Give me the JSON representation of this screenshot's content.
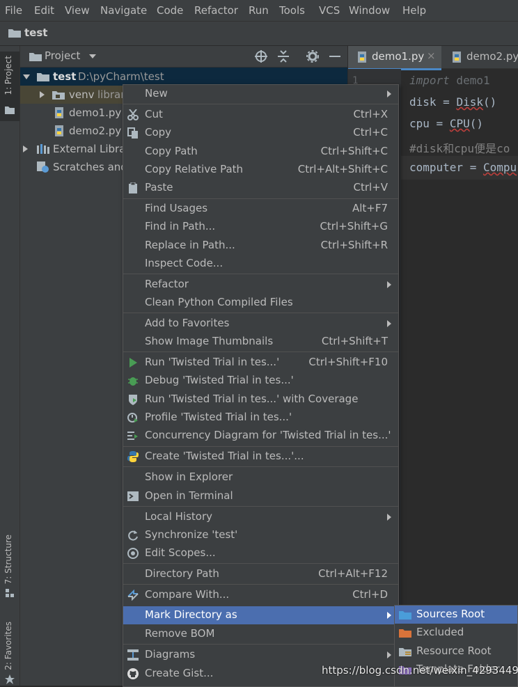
{
  "menu_bar": [
    "File",
    "Edit",
    "View",
    "Navigate",
    "Code",
    "Refactor",
    "Run",
    "Tools",
    "VCS",
    "Window",
    "Help"
  ],
  "navbar": {
    "folder": "test"
  },
  "tool_windows": {
    "project": "1: Project",
    "structure": "7: Structure",
    "favorites": "2: Favorites"
  },
  "project_panel": {
    "title": "Project",
    "tree": [
      {
        "name": "test",
        "path": "D:\\pyCharm\\test"
      },
      {
        "name": "venv",
        "suffix": "librar"
      },
      {
        "name": "demo1.py"
      },
      {
        "name": "demo2.py"
      },
      {
        "name": "External Librar"
      },
      {
        "name": "Scratches and"
      }
    ]
  },
  "editor": {
    "tabs": [
      "demo1.py",
      "demo2.py"
    ],
    "line_number": "1",
    "lines": {
      "l1_kw": "import",
      "l1_rest": " demo1",
      "l2_a": "disk",
      "l2_b": " = ",
      "l2_c": "Disk",
      "l2_d": "()",
      "l3_a": "cpu",
      "l3_b": " = ",
      "l3_c": "CPU",
      "l3_d": "()",
      "l4": "#disk和cpu便是co",
      "l5_a": "computer",
      "l5_b": " = ",
      "l5_c": "Compu"
    }
  },
  "context_menu": {
    "new": "New",
    "cut": "Cut",
    "cut_sc": "Ctrl+X",
    "copy": "Copy",
    "copy_sc": "Ctrl+C",
    "copy_path": "Copy Path",
    "copy_path_sc": "Ctrl+Shift+C",
    "copy_rel": "Copy Relative Path",
    "copy_rel_sc": "Ctrl+Alt+Shift+C",
    "paste": "Paste",
    "paste_sc": "Ctrl+V",
    "find_usages": "Find Usages",
    "find_usages_sc": "Alt+F7",
    "find_in_path": "Find in Path...",
    "find_in_path_sc": "Ctrl+Shift+G",
    "replace_in_path": "Replace in Path...",
    "replace_in_path_sc": "Ctrl+Shift+R",
    "inspect": "Inspect Code...",
    "refactor": "Refactor",
    "clean": "Clean Python Compiled Files",
    "add_fav": "Add to Favorites",
    "thumbs": "Show Image Thumbnails",
    "thumbs_sc": "Ctrl+Shift+T",
    "run": "Run 'Twisted Trial in tes...'",
    "run_sc": "Ctrl+Shift+F10",
    "debug": "Debug 'Twisted Trial in tes...'",
    "coverage": "Run 'Twisted Trial in tes...' with Coverage",
    "profile": "Profile 'Twisted Trial in tes...'",
    "concurrency": "Concurrency Diagram for 'Twisted Trial in tes...'",
    "create": "Create 'Twisted Trial in tes...'...",
    "explorer": "Show in Explorer",
    "terminal": "Open in Terminal",
    "history": "Local History",
    "sync": "Synchronize 'test'",
    "scopes": "Edit Scopes...",
    "dir_path": "Directory Path",
    "dir_path_sc": "Ctrl+Alt+F12",
    "compare": "Compare With...",
    "compare_sc": "Ctrl+D",
    "mark": "Mark Directory as",
    "remove_bom": "Remove BOM",
    "diagrams": "Diagrams",
    "gist": "Create Gist..."
  },
  "submenu": [
    "Sources Root",
    "Excluded",
    "Resource Root",
    "Template Folder"
  ],
  "watermark": "https://blog.csdn.net/weixin_42934493",
  "colors": {
    "selection": "#4b6eaf",
    "panel": "#3c3f41",
    "editor": "#2b2b2b",
    "keyword": "#cc7832",
    "folder_blue": "#4a9dd9",
    "folder_orange": "#d9733a"
  }
}
